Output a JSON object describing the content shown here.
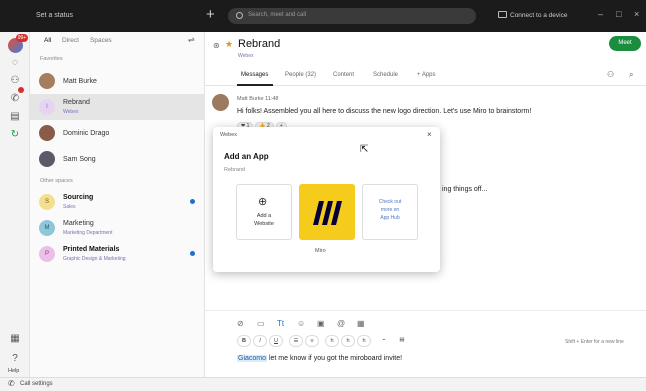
{
  "titlebar": {
    "status": "Set a status",
    "search_placeholder": "Search, meet and call",
    "connect": "Connect to a device",
    "minimize": "–",
    "maximize": "□",
    "close": "×"
  },
  "rail": {
    "badge": "99+",
    "help": "Help"
  },
  "list": {
    "filters": [
      "All",
      "Direct",
      "Spaces"
    ],
    "favorites_label": "Favorites",
    "other_label": "Other spaces",
    "favorites": [
      {
        "name": "Matt Burke",
        "sub": ""
      },
      {
        "name": "Rebrand",
        "sub": "Webex",
        "initial": "I"
      },
      {
        "name": "Dominic Drago",
        "sub": ""
      },
      {
        "name": "Sam Song",
        "sub": ""
      }
    ],
    "others": [
      {
        "name": "Sourcing",
        "sub": "Sales",
        "initial": "S"
      },
      {
        "name": "Marketing",
        "sub": "Marketing Department",
        "initial": "M"
      },
      {
        "name": "Printed Materials",
        "sub": "Graphic Design & Marketing",
        "initial": "P"
      }
    ]
  },
  "main": {
    "title": "Rebrand",
    "subtitle": "Webex",
    "meet": "Meet",
    "tabs": [
      "Messages",
      "People (32)",
      "Content",
      "Schedule",
      "+ Apps"
    ],
    "msg_author": "Matt Burke  11:48",
    "msg_text": "Hi folks! Assembled you all here to discuss the new logo direction. Let's use Miro to brainstorm!",
    "reactions": [
      "❤ 1",
      "👍 2",
      "+"
    ],
    "fragment": "ing things off...",
    "shift_hint": "Shift + Enter for a new line",
    "compose_mention": "Giacomo",
    "compose_rest": " let me know if you got the miroboard invite!"
  },
  "dialog": {
    "top": "Webex",
    "title": "Add an App",
    "sub": "Rebrand",
    "card1_l1": "Add a",
    "card1_l2": "Website",
    "card3_l1": "Check out",
    "card3_l2": "more on",
    "card3_l3": "App Hub",
    "miro_label": "Miro"
  },
  "bottom": {
    "call": "Call settings"
  },
  "colors": {
    "meet": "#1b8d3f",
    "miro": "#f5cc1b",
    "unread": "#1a73c9"
  }
}
